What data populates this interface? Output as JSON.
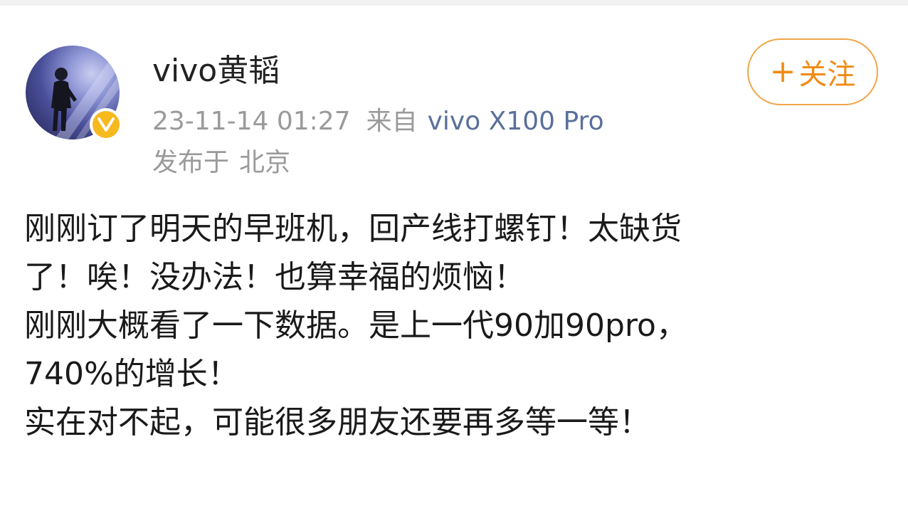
{
  "post": {
    "author": {
      "name": "vivo黄韬",
      "avatar_icon": "person-on-stage-avatar",
      "badge_icon": "verified-v-badge",
      "badge_text": "v"
    },
    "follow_button": {
      "icon": "plus-icon",
      "plus": "+",
      "label": "关注"
    },
    "meta": {
      "timestamp": "23-11-14 01:27",
      "source_prefix": "来自",
      "device": "vivo X100 Pro",
      "location_prefix": "发布于",
      "location": "北京"
    },
    "content_lines": [
      "刚刚订了明天的早班机，回产线打螺钉！太缺货",
      "了！唉！没办法！也算幸福的烦恼！",
      "刚刚大概看了一下数据。是上一代90加90pro，",
      "740%的增长！",
      "实在对不起，可能很多朋友还要再多等一等！"
    ]
  },
  "colors": {
    "accent_orange": "#f08c16",
    "device_link": "#5a6f9a",
    "meta_gray": "#9a9a9a",
    "verified_gold": "#f6b91e"
  }
}
